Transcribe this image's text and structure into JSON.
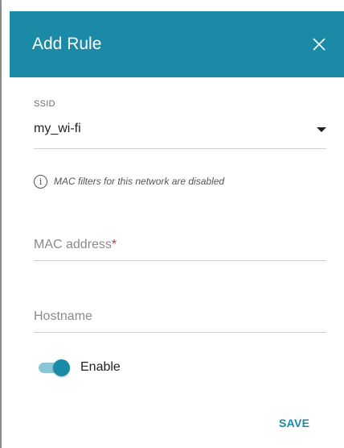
{
  "dialog": {
    "title": "Add Rule",
    "header_color": "#1a8aa6",
    "close_icon": "close-icon"
  },
  "ssid": {
    "label": "SSID",
    "selected_value": "my_wi-fi"
  },
  "info": {
    "icon": "info-icon",
    "icon_glyph": "i",
    "text": "MAC filters for this network are disabled"
  },
  "mac_address": {
    "placeholder": "MAC address",
    "required_mark": "*",
    "value": ""
  },
  "hostname": {
    "placeholder": "Hostname",
    "value": ""
  },
  "enable_toggle": {
    "label": "Enable",
    "checked": true
  },
  "actions": {
    "save_label": "SAVE"
  }
}
